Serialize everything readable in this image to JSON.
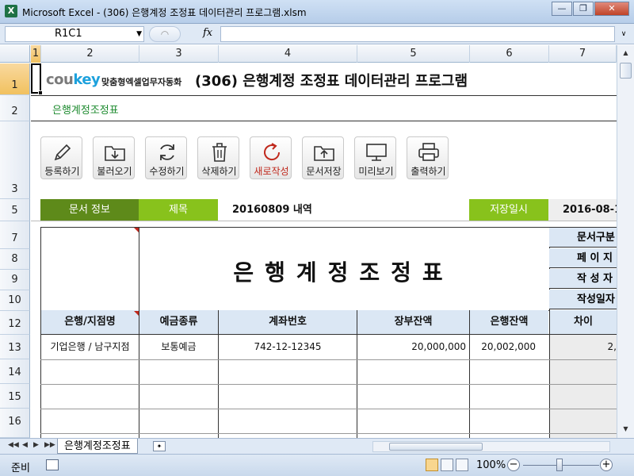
{
  "window": {
    "app_icon": "X",
    "title": "Microsoft Excel - (306) 은행계정 조정표 데이터관리 프로그램.xlsm",
    "buttons": [
      "minimize-icon",
      "restore-icon",
      "close-icon"
    ]
  },
  "formula_bar": {
    "name_box": "R1C1",
    "fx": "fx",
    "formula": ""
  },
  "columns": [
    "1",
    "2",
    "3",
    "4",
    "5",
    "6",
    "7"
  ],
  "rows": [
    "1",
    "2",
    "3",
    "5",
    "7",
    "8",
    "9",
    "10",
    "12",
    "13",
    "14",
    "15",
    "16"
  ],
  "brand": {
    "logo_prefix": "cou",
    "logo_k": "key",
    "tagline": "맞춤형엑셀업무자동화",
    "program_title": "(306) 은행계정 조정표 데이터관리 프로그램"
  },
  "subtitle": "은행계정조정표",
  "toolbar": [
    {
      "label": "등록하기",
      "icon": "pencil-icon"
    },
    {
      "label": "불러오기",
      "icon": "folder-download-icon"
    },
    {
      "label": "수정하기",
      "icon": "refresh-icon"
    },
    {
      "label": "삭제하기",
      "icon": "trash-icon"
    },
    {
      "label": "새로작성",
      "icon": "new-refresh-icon"
    },
    {
      "label": "문서저장",
      "icon": "folder-upload-icon"
    },
    {
      "label": "미리보기",
      "icon": "monitor-icon"
    },
    {
      "label": "출력하기",
      "icon": "printer-icon"
    }
  ],
  "info_row": {
    "doc_info_label": "문서 정보",
    "title_label": "제목",
    "title_value": "20160809 내역",
    "saved_label": "저장일시",
    "saved_value": "2016-08-1"
  },
  "sheet_title": "은행계정조정표",
  "side_labels": [
    "문서구분",
    "페 이 지",
    "작 성 자",
    "작성일자"
  ],
  "table": {
    "headers": [
      "은행/지점명",
      "예금종류",
      "계좌번호",
      "장부잔액",
      "은행잔액",
      "차이"
    ],
    "rows": [
      [
        "기업은행 / 남구지점",
        "보통예금",
        "742-12-12345",
        "20,000,000",
        "20,002,000",
        "2,"
      ]
    ]
  },
  "sheet_tab": "은행계정조정표",
  "status": {
    "ready": "준비",
    "zoom": "100%"
  },
  "colors": {
    "dark_green": "#5e8a1a",
    "light_green": "#88c21c",
    "header_blue": "#dbe7f4",
    "subtitle_green": "#1c8a2e",
    "new_red": "#c0281c"
  }
}
